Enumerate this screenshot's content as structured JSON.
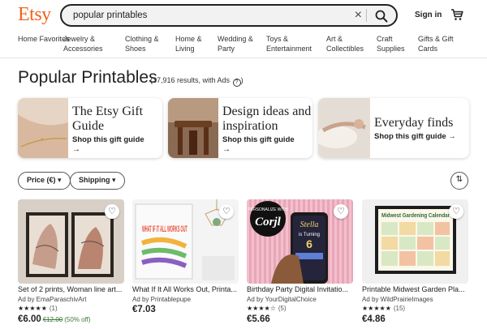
{
  "brand": {
    "logo_text": "Etsy",
    "accent_color": "#F1641E"
  },
  "search": {
    "value": "popular printables",
    "clear_icon": "close-icon",
    "submit_icon": "search-icon"
  },
  "header": {
    "signin_label": "Sign in",
    "cart_icon": "cart-icon"
  },
  "nav": {
    "items": [
      {
        "label": "Home Favorites"
      },
      {
        "label": "Jewelry & Accessories"
      },
      {
        "label": "Clothing & Shoes"
      },
      {
        "label": "Home & Living"
      },
      {
        "label": "Wedding & Party"
      },
      {
        "label": "Toys & Entertainment"
      },
      {
        "label": "Art & Collectibles"
      },
      {
        "label": "Craft Supplies"
      },
      {
        "label": "Gifts & Gift Cards"
      }
    ]
  },
  "page": {
    "title": "Popular Printables",
    "results_text": "(37,916 results, with Ads",
    "results_suffix": ")",
    "help_icon": "question-icon"
  },
  "promos": [
    {
      "title": "The Etsy Gift Guide",
      "cta": "Shop this gift guide"
    },
    {
      "title": "Design ideas and inspiration",
      "cta": "Shop this gift guide"
    },
    {
      "title": "Everyday finds",
      "cta": "Shop this gift guide"
    }
  ],
  "filters": [
    {
      "label": "Price (€)"
    },
    {
      "label": "Shipping"
    }
  ],
  "sort_icon": "sort-icon",
  "listings": [
    {
      "title": "Set of 2 prints, Woman line art...",
      "seller": "Ad by EmaParaschivArt",
      "stars": "★★★★★",
      "reviews": "(1)",
      "price": "€6.00",
      "old_price": "€12.00",
      "discount": "(50% off)"
    },
    {
      "title": "What If It All Works Out, Printa...",
      "seller": "Ad by Printablepupe",
      "stars": "",
      "reviews": "",
      "price": "€7.03",
      "old_price": "",
      "discount": ""
    },
    {
      "title": "Birthday Party Digital Invitatio...",
      "seller": "Ad by YourDigitalChoice",
      "stars": "★★★★☆",
      "reviews": "(5)",
      "price": "€5.66",
      "old_price": "",
      "discount": ""
    },
    {
      "title": "Printable Midwest Garden Pla...",
      "seller": "Ad by WildPrairieImages",
      "stars": "★★★★★",
      "reviews": "(15)",
      "price": "€4.86",
      "old_price": "",
      "discount": ""
    }
  ],
  "listing_images": {
    "card2_text": "WHAT IF IT ALL WORKS OUT",
    "card3_badge": "PERSONALIZE WITH",
    "card3_logo": "Corjl",
    "card3_phone_name": "Stella",
    "card3_phone_sub": "is Turning",
    "card3_phone_num": "6",
    "card4_heading": "Midwest Gardening Calendar"
  }
}
